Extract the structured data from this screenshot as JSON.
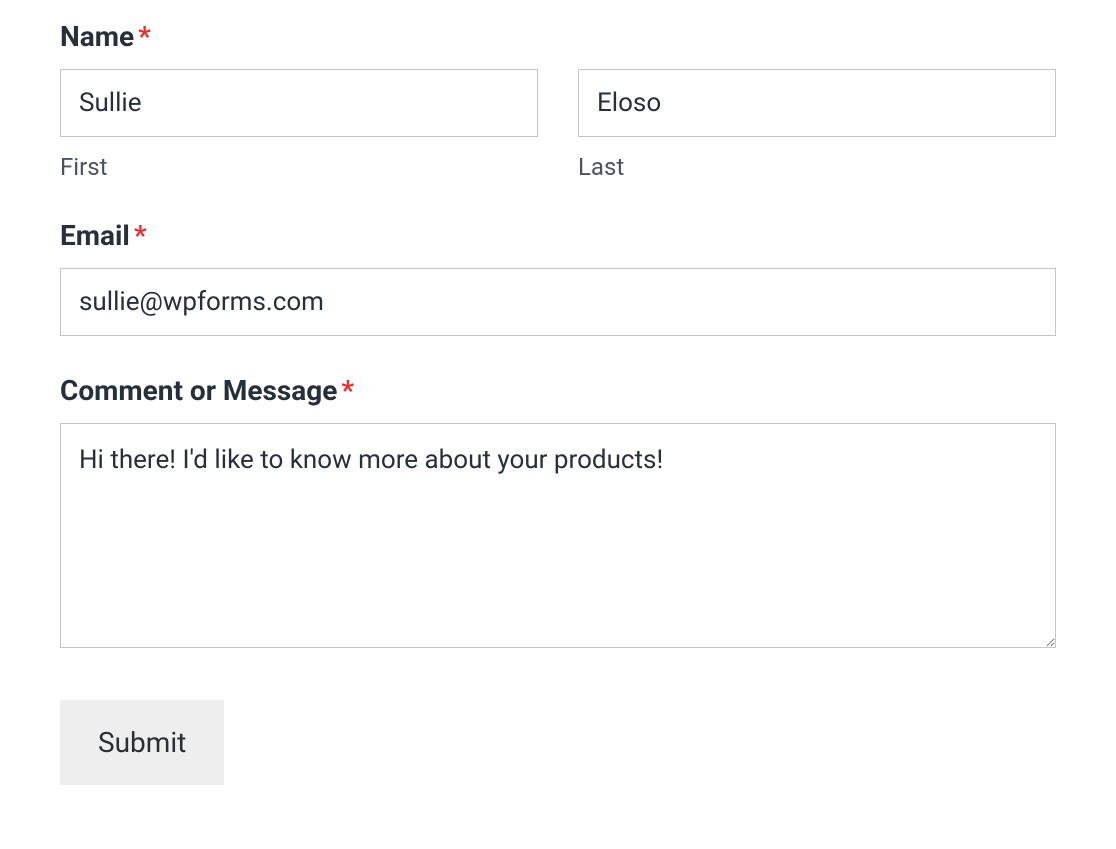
{
  "form": {
    "name": {
      "label": "Name",
      "required_marker": "*",
      "first": {
        "value": "Sullie",
        "sublabel": "First"
      },
      "last": {
        "value": "Eloso",
        "sublabel": "Last"
      }
    },
    "email": {
      "label": "Email",
      "required_marker": "*",
      "value": "sullie@wpforms.com"
    },
    "message": {
      "label": "Comment or Message",
      "required_marker": "*",
      "value": "Hi there! I'd like to know more about your products!"
    },
    "submit": {
      "label": "Submit"
    }
  }
}
